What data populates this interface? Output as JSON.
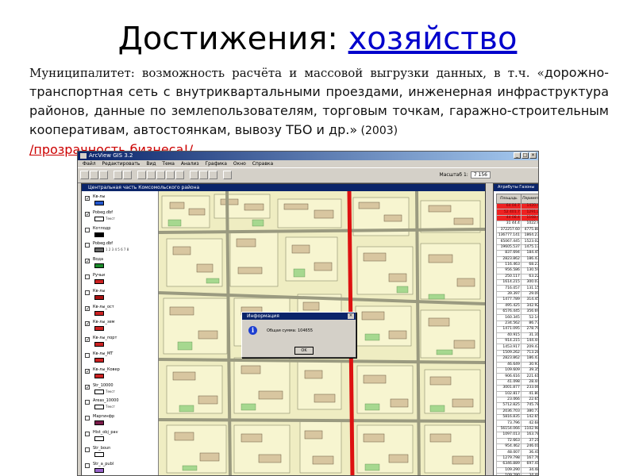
{
  "slide": {
    "title_plain": "Достижения: ",
    "title_link": "хозяйство",
    "para_serif": "Муниципалитет: возможность расчёта и массовой выгрузки данных, в т.ч. «",
    "para_body": "дорожно-транспортная сеть с внутриквартальными проездами, инженерная инфраструктура районов, данные по землепользователям, торговым точкам, гаражно-строительным кооперативам, автостоянкам, вывозу ТБО и др.»",
    "para_year": " (2003)",
    "para_link": "/прозрачность бизнеса!/"
  },
  "app": {
    "title": "ArcView GIS 3.2",
    "menus": [
      "Файл",
      "Редактировать",
      "Вид",
      "Тема",
      "Анализ",
      "Графика",
      "Окно",
      "Справка"
    ],
    "scale_label": "Масштаб 1:",
    "scale_value": "7 156",
    "view_title": "Центральная часть Комсомольского района",
    "layers": [
      {
        "label": "Кв-лы",
        "color": "#2255cc",
        "checked": true,
        "sub": ""
      },
      {
        "label": "Pobeg.dbf",
        "color": "#ffffff",
        "checked": true,
        "sub": "Текст"
      },
      {
        "label": "Котлодр",
        "color": "#000000",
        "checked": false,
        "sub": ""
      },
      {
        "label": "Pobeg.dbf",
        "color": "#666666",
        "checked": false,
        "sub": "1 2 3 4 5 6 7 8"
      },
      {
        "label": "Вода",
        "color": "#1a8a2a",
        "checked": true,
        "sub": ""
      },
      {
        "label": "Ручьи",
        "color": "#cc2222",
        "checked": false,
        "sub": ""
      },
      {
        "label": "Кв-лы",
        "color": "#aa1111",
        "checked": false,
        "sub": ""
      },
      {
        "label": "Кв-лы_ост",
        "color": "#cc2222",
        "checked": true,
        "sub": ""
      },
      {
        "label": "Кв-лы_зем",
        "color": "#cc2222",
        "checked": true,
        "sub": ""
      },
      {
        "label": "Кв-лы_порт",
        "color": "#cc2222",
        "checked": true,
        "sub": ""
      },
      {
        "label": "Кв-лы_МТ",
        "color": "#cc2222",
        "checked": false,
        "sub": ""
      },
      {
        "label": "Кв-лы_Ковер",
        "color": "#cc2222",
        "checked": true,
        "sub": ""
      },
      {
        "label": "Str_10000",
        "color": "#ffffff",
        "checked": true,
        "sub": "Текст"
      },
      {
        "label": "Areas_10000",
        "color": "#ffffff",
        "checked": false,
        "sub": "Текст"
      },
      {
        "label": "Маргинфр",
        "color": "#7a1a4a",
        "checked": false,
        "sub": ""
      },
      {
        "label": "Hist_obj_pav",
        "color": "#ffffff",
        "checked": false,
        "sub": ""
      },
      {
        "label": "Str_boun",
        "color": "#ffffff",
        "checked": false,
        "sub": ""
      },
      {
        "label": "Str_a_publ",
        "color": "#9a66cc",
        "checked": false,
        "sub": ""
      }
    ],
    "dialog": {
      "title": "Информация",
      "text": "Общая сумма: 104655",
      "ok": "OK"
    },
    "attr_table": {
      "title": "Атрибуты Газоны",
      "columns": [
        "Площадь",
        "Периметр",
        "Кол. площадь"
      ],
      "highlighted_rows": 3,
      "rows": [
        [
          "64 04.7",
          "1420.40",
          "4003.80"
        ],
        [
          "52 401.7",
          "1291.20",
          "3108.10"
        ],
        [
          "44 08.4",
          "1168.40",
          "3051.78"
        ],
        [
          "31 44.4",
          "1022.90",
          "2704.60"
        ],
        [
          "372257.60",
          "4775.880",
          "223057.81"
        ],
        [
          "136777.141",
          "1864.232",
          "826862.85"
        ],
        [
          "65067.445",
          "1523.020",
          "398404.67"
        ],
        [
          "19605.537",
          "1475.175",
          "117630.22"
        ],
        [
          "837.694",
          "184.456",
          "3926.16"
        ],
        [
          "2823.862",
          "186.437",
          "16943.29"
        ],
        [
          "116.463",
          "68.231",
          "698.78"
        ],
        [
          "956.586",
          "130.594",
          "5703.52"
        ],
        [
          "250.117",
          "63.229",
          "1500.70"
        ],
        [
          "1614.215",
          "300.071",
          "9685.31"
        ],
        [
          "716.057",
          "131.153",
          "4296.31"
        ],
        [
          "39.397",
          "29.097",
          "236.37"
        ],
        [
          "1477.789",
          "314.459",
          "8866.73"
        ],
        [
          "495.425",
          "342.923",
          "2972.55"
        ],
        [
          "6576.445",
          "356.690",
          "39458.67"
        ],
        [
          "160.345",
          "52.149",
          "962.07"
        ],
        [
          "234.562",
          "86.771",
          "1407.38"
        ],
        [
          "1471.095",
          "278.791",
          "8826.57"
        ],
        [
          "40.915",
          "31.313",
          "245.49"
        ],
        [
          "914.215",
          "144.449",
          "5485.29"
        ],
        [
          "1453.917",
          "209.476",
          "8723.50"
        ],
        [
          "1509.262",
          "713.280",
          "9405.57"
        ],
        [
          "2823.862",
          "186.436",
          "16943.19"
        ],
        [
          "46.649",
          "30.939",
          "279.89"
        ],
        [
          "109.609",
          "39.356",
          "659.29"
        ],
        [
          "906.616",
          "221.616",
          "5439.70"
        ],
        [
          "41.098",
          "28.440",
          "246.59"
        ],
        [
          "3001.877",
          "233.065",
          "18011.23"
        ],
        [
          "102.817",
          "41.809",
          "616.90"
        ],
        [
          "23.066",
          "22.658",
          "138.24"
        ],
        [
          "5712.825",
          "745.784",
          "19276.57"
        ],
        [
          "2036.703",
          "380.773",
          "12220.22"
        ],
        [
          "5816.835",
          "142.652",
          "34901.01"
        ],
        [
          "73.796",
          "42.683",
          "442.78"
        ],
        [
          "56154.066",
          "1102.985",
          "336924.40"
        ],
        [
          "1097.013",
          "163.787",
          "6582.08"
        ],
        [
          "72.663",
          "37.217",
          "435.98"
        ],
        [
          "954.462",
          "246.011",
          "5726.77"
        ],
        [
          "48.007",
          "36.413",
          "288.04"
        ],
        [
          "1279.798",
          "167.764",
          "7678.79"
        ],
        [
          "6346.889",
          "697.413",
          "38081.33"
        ],
        [
          "109.290",
          "34.484",
          "655.44"
        ],
        [
          "109.290",
          "34.484",
          "655.44"
        ],
        [
          "1012.463",
          "144.160",
          "6074.78"
        ],
        [
          "1012.463",
          "144.160",
          "6074.78"
        ]
      ]
    }
  }
}
